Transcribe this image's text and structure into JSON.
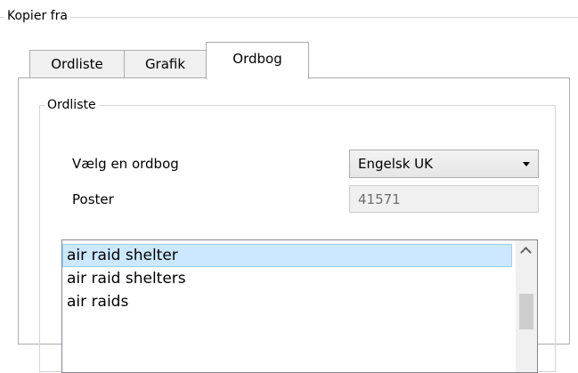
{
  "group": {
    "title": "Kopier fra"
  },
  "tabs": [
    {
      "label": "Ordliste"
    },
    {
      "label": "Grafik"
    },
    {
      "label": "Ordbog"
    }
  ],
  "panel": {
    "group_title": "Ordliste",
    "dictionary_label": "Vælg en ordbog",
    "dictionary_value": "Engelsk UK",
    "entries_label": "Poster",
    "entries_value": "41571",
    "list_items": [
      "air raid shelter",
      "air raid shelters",
      "air raids"
    ]
  }
}
